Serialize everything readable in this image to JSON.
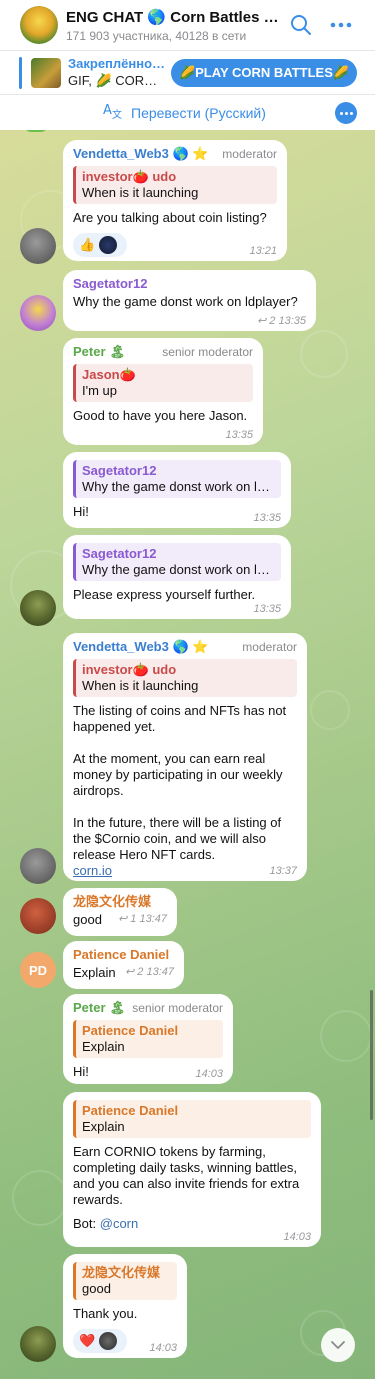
{
  "header": {
    "title": "ENG CHAT 🌎 Corn Battles Channel",
    "subtitle": "171 903 участника, 40128 в сети",
    "search_icon": "search-icon",
    "more_icon": "more-icon"
  },
  "pinned": {
    "title": "Закреплённое сообщение",
    "body": "GIF, 🌽 CORN BATTLES",
    "button": "🌽PLAY CORN BATTLES🌽"
  },
  "translate": {
    "label": "Перевести (Русский)"
  },
  "messages": [
    {
      "sender": "Vendetta_Web3 🌎 ⭐",
      "role": "moderator",
      "reply_name": "investor🍅 udo",
      "reply_text": "When is it launching",
      "text": "Are you talking about coin listing?",
      "reactions": [
        "👍",
        ""
      ],
      "time": "13:21"
    },
    {
      "sender": "Sagetator12",
      "text": "Why the game donst work on ldplayer?",
      "replies": "2",
      "time": "13:35"
    },
    {
      "sender": "Peter 🏝",
      "role": "senior moderator",
      "reply_name": "Jason🍅",
      "reply_text": "I'm up",
      "text": "Good to have you here Jason.",
      "time": "13:35"
    },
    {
      "reply_name": "Sagetator12",
      "reply_text": "Why the game donst work on ldplayer?",
      "text": "Hi!",
      "time": "13:35"
    },
    {
      "reply_name": "Sagetator12",
      "reply_text": "Why the game donst work on ldplayer?",
      "text": "Please express yourself further.",
      "time": "13:35"
    },
    {
      "sender": "Vendetta_Web3 🌎 ⭐",
      "role": "moderator",
      "reply_name": "investor🍅 udo",
      "reply_text": "When is it launching",
      "paragraphs": [
        "The listing of coins and NFTs has not happened yet.",
        "At the moment, you can earn real money by participating in our weekly airdrops.",
        "In the future, there will be a listing of the $Cornio coin, and we will also release Hero NFT cards."
      ],
      "link": "corn.io",
      "time": "13:37"
    },
    {
      "sender": "龙隐文化传媒",
      "text": "good",
      "replies": "1",
      "time": "13:47"
    },
    {
      "sender": "Patience Daniel",
      "avatar_initials": "PD",
      "text": "Explain",
      "replies": "2",
      "time": "13:47"
    },
    {
      "sender": "Peter 🏝",
      "role": "senior moderator",
      "reply_name": "Patience Daniel",
      "reply_text": "Explain",
      "text": "Hi!",
      "time": "14:03"
    },
    {
      "reply_name": "Patience Daniel",
      "reply_text": "Explain",
      "text": "Earn CORNIO tokens by farming, completing daily tasks, winning battles, and you can also invite friends for extra rewards.",
      "bot_label": "Bot: ",
      "bot_link": "@corn",
      "time": "14:03"
    },
    {
      "reply_name": "龙隐文化传媒",
      "reply_text": "good",
      "text": "Thank you.",
      "reactions": [
        "❤️",
        ""
      ],
      "time": "14:03"
    }
  ],
  "colors": {
    "accent": "#3a8ee6",
    "vendetta": "#3a7fcf",
    "sagetator": "#8a5ad0",
    "peter": "#5aa84a",
    "reply_red": "#c94a4a",
    "orange": "#d9782a"
  }
}
